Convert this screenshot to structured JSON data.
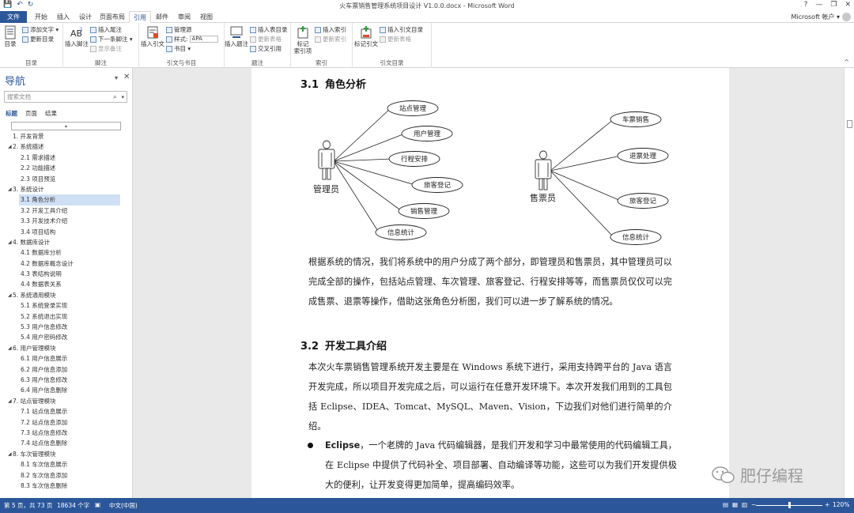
{
  "window": {
    "title": "火车票销售管理系统项目设计 V1.0.0.docx - Microsoft Word",
    "help": "?",
    "minimize": "—",
    "restore": "❐",
    "close": "✕"
  },
  "qat": {
    "save": "💾",
    "undo": "↶",
    "redo": "↻"
  },
  "tabs": [
    {
      "label": "文件"
    },
    {
      "label": "开始"
    },
    {
      "label": "插入"
    },
    {
      "label": "设计"
    },
    {
      "label": "页面布局"
    },
    {
      "label": "引用"
    },
    {
      "label": "邮件"
    },
    {
      "label": "审阅"
    },
    {
      "label": "视图"
    }
  ],
  "account": "Microsoft 帐户 ▾",
  "ribbon": {
    "toc": {
      "big": "目录",
      "add_text": "添加文字 ▾",
      "update_toc": "更新目录",
      "group": "目录"
    },
    "footnote": {
      "insert_footnote": "插入脚注",
      "insert_endnote": "插入尾注",
      "next_footnote": "下一条脚注 ▾",
      "show_notes": "显示备注",
      "group": "脚注"
    },
    "citation": {
      "insert_citation": "插入引文",
      "manage_sources": "管理源",
      "style_label": "样式:",
      "style_value": "APA",
      "bibliography": "书目 ▾",
      "group": "引文与书目"
    },
    "caption": {
      "insert_caption": "插入题注",
      "insert_table_of_figures": "插入表目录",
      "update_table": "更新表格",
      "cross_reference": "交叉引用",
      "group": "题注"
    },
    "index": {
      "mark_entry": "标记\n索引项",
      "insert_index": "插入索引",
      "update_index": "更新索引",
      "group": "索引"
    },
    "authorities": {
      "mark_citation": "标记引文",
      "insert_toa": "插入引文目录",
      "update_table": "更新表格",
      "group": "引文目录"
    },
    "collapse": "^"
  },
  "nav": {
    "title": "导航",
    "ctrl": "▾",
    "close": "✕",
    "search_placeholder": "搜索文档",
    "search_icon": "⌕",
    "search_dd": "▾",
    "tabs": [
      "标题",
      "页面",
      "结果"
    ],
    "collapse_marker": "▴",
    "items": [
      {
        "label": "1. 开发背景",
        "level": 1,
        "expandable": false
      },
      {
        "label": "2. 系统描述",
        "level": 1,
        "expandable": true
      },
      {
        "label": "2.1 需求描述",
        "level": 2
      },
      {
        "label": "2.2 功能描述",
        "level": 2
      },
      {
        "label": "2.3 项目预览",
        "level": 2
      },
      {
        "label": "3. 系统设计",
        "level": 1,
        "expandable": true
      },
      {
        "label": "3.1 角色分析",
        "level": 2,
        "selected": true
      },
      {
        "label": "3.2 开发工具介绍",
        "level": 2
      },
      {
        "label": "3.3 开发技术介绍",
        "level": 2
      },
      {
        "label": "3.4 项目结构",
        "level": 2
      },
      {
        "label": "4. 数据库设计",
        "level": 1,
        "expandable": true
      },
      {
        "label": "4.1 数据库分析",
        "level": 2
      },
      {
        "label": "4.2 数据库概念设计",
        "level": 2
      },
      {
        "label": "4.3 表结构说明",
        "level": 2
      },
      {
        "label": "4.4 数据表关系",
        "level": 2
      },
      {
        "label": "5. 系统通用模块",
        "level": 1,
        "expandable": true
      },
      {
        "label": "5.1 系统登录实现",
        "level": 2
      },
      {
        "label": "5.2 系统退出实现",
        "level": 2
      },
      {
        "label": "5.3 用户信息修改",
        "level": 2
      },
      {
        "label": "5.4 用户密码修改",
        "level": 2
      },
      {
        "label": "6. 用户管理模块",
        "level": 1,
        "expandable": true
      },
      {
        "label": "6.1 用户信息展示",
        "level": 2
      },
      {
        "label": "6.2 用户信息添加",
        "level": 2
      },
      {
        "label": "6.3 用户信息修改",
        "level": 2
      },
      {
        "label": "6.4 用户信息删除",
        "level": 2
      },
      {
        "label": "7. 站点管理模块",
        "level": 1,
        "expandable": true
      },
      {
        "label": "7.1 站点信息展示",
        "level": 2
      },
      {
        "label": "7.2 站点信息添加",
        "level": 2
      },
      {
        "label": "7.3 站点信息修改",
        "level": 2
      },
      {
        "label": "7.4 站点信息删除",
        "level": 2
      },
      {
        "label": "8. 车次管理模块",
        "level": 1,
        "expandable": true
      },
      {
        "label": "8.1 车次信息展示",
        "level": 2
      },
      {
        "label": "8.2 车次信息添加",
        "level": 2
      },
      {
        "label": "8.3 车次信息删除",
        "level": 2
      }
    ]
  },
  "doc": {
    "sec31": {
      "num": "3.1",
      "title": "角色分析"
    },
    "diagram": {
      "admin_label": "管理员",
      "admin_cases": [
        "站点管理",
        "用户管理",
        "行程安排",
        "旅客登记",
        "销售管理",
        "信息统计"
      ],
      "seller_label": "售票员",
      "seller_cases": [
        "车票销售",
        "退票处理",
        "旅客登记",
        "信息统计"
      ]
    },
    "para1": "根据系统的情况，我们将系统中的用户分成了两个部分，即管理员和售票员，其中管理员可以完成全部的操作，包括站点管理、车次管理、旅客登记、行程安排等等，而售票员仅仅可以完成售票、退票等操作，借助这张角色分析图，我们可以进一步了解系统的情况。",
    "sec32": {
      "num": "3.2",
      "title": "开发工具介绍"
    },
    "para2": "本次火车票销售管理系统开发主要是在 Windows 系统下进行，采用支持跨平台的 Java 语言开发完成，所以项目开发完成之后，可以运行在任意开发环境下。本次开发我们用到的工具包括 Eclipse、IDEA、Tomcat、MySQL、Maven、Vision，下边我们对他们进行简单的介绍。",
    "bullet1_term": "Eclipse",
    "bullet1_text": "，一个老牌的 Java 代码编辑器，是我们开发和学习中最常使用的代码编辑工具，在 Eclipse 中提供了代码补全、项目部署、自动编译等功能，这些可以为我们开发提供极大的便利，让开发变得更加简单，提高编码效率。"
  },
  "watermark": "肥仔编程",
  "status": {
    "page": "第 5 页，共 73 页",
    "words": "18634 个字",
    "lang": "中文(中国)",
    "zoom_minus": "−",
    "zoom_plus": "+",
    "zoom": "120%"
  },
  "colors": {
    "accent": "#2b579a",
    "selection": "#cfe0f5"
  }
}
